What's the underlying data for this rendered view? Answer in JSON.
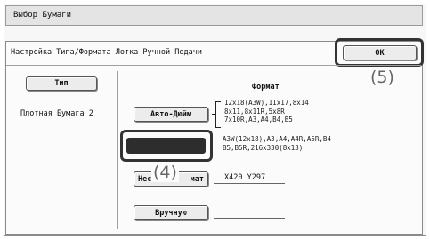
{
  "window": {
    "title": "Выбор Бумаги"
  },
  "panel": {
    "subtitle": "Настройка Типа/Формата Лотка Ручной Подачи"
  },
  "ok_button": {
    "label": "OK",
    "callout": "(5)"
  },
  "left": {
    "type_button": "Тип",
    "selected_type": "Плотная Бумага 2"
  },
  "format": {
    "heading": "Формат",
    "auto_inch_button": "Авто-Дюйм",
    "auto_inch_sizes": "12x18(A3W),11x17,8x14\n8x11,8x11R,5x8R\n7x10R,A3,A4,B4,B5",
    "selected_button_callout": "(4)",
    "selected_sizes": "A3W(12x18),A3,A4,A4R,A5R,B4\nB5,B5R,216x330(8x13)",
    "nonstandard_button_start": "Нес",
    "nonstandard_button_end": "мат",
    "nonstandard_size": "X420 Y297",
    "manual_button": "Вручную"
  }
}
